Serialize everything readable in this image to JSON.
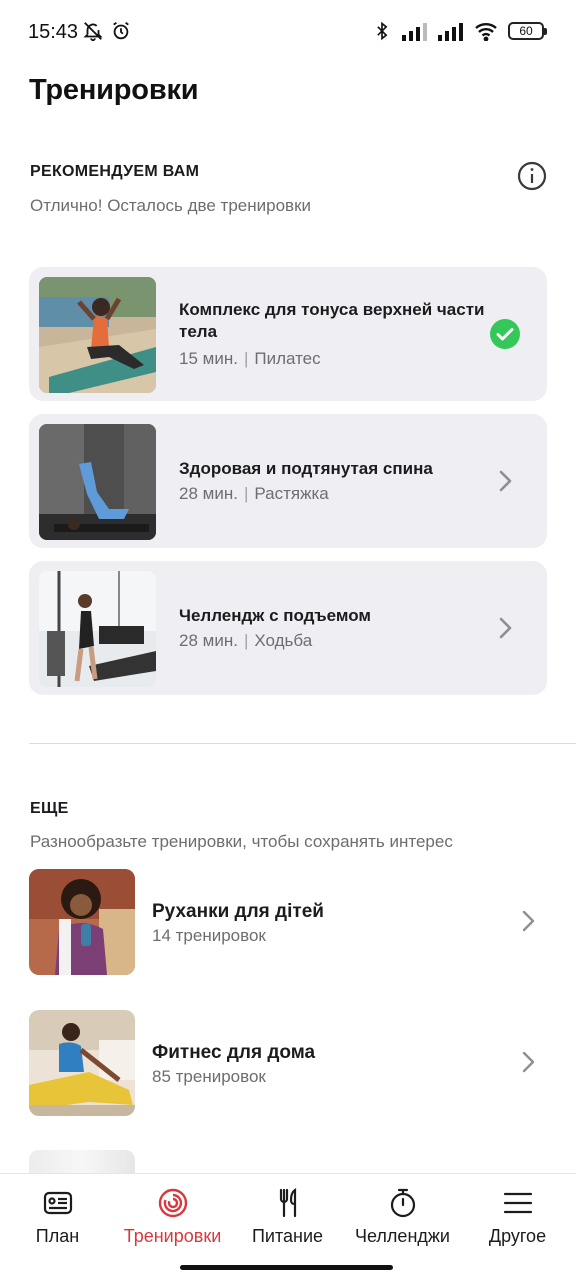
{
  "status": {
    "time": "15:43",
    "battery": "60",
    "icons": [
      "bell-off-icon",
      "alarm-icon",
      "bluetooth-icon",
      "signal-icon",
      "signal-icon",
      "wifi-icon",
      "battery-icon"
    ]
  },
  "page": {
    "title": "Тренировки"
  },
  "recommended": {
    "title": "РЕКОМЕНДУЕМ ВАМ",
    "subtitle": "Отлично! Осталось две тренировки",
    "info_icon": "info-icon",
    "items": [
      {
        "title": "Комплекс для тонуса верхней части тела",
        "duration": "15 мин.",
        "category": "Пилатес",
        "status": "completed",
        "icon": "check-circle-icon"
      },
      {
        "title": "Здоровая и подтянутая спина",
        "duration": "28 мин.",
        "category": "Растяжка",
        "status": "open",
        "icon": "chevron-right-icon"
      },
      {
        "title": "Челлендж с подъемом",
        "duration": "28 мин.",
        "category": "Ходьба",
        "status": "open",
        "icon": "chevron-right-icon"
      }
    ]
  },
  "more": {
    "title": "ЕЩЕ",
    "subtitle": "Разнообразьте тренировки, чтобы сохранять интерес",
    "items": [
      {
        "title": "Руханки для дітей",
        "count": "14 тренировок"
      },
      {
        "title": "Фитнес для дома",
        "count": "85 тренировок"
      }
    ]
  },
  "nav": {
    "items": [
      {
        "label": "План",
        "icon": "plan-card-icon",
        "active": false
      },
      {
        "label": "Тренировки",
        "icon": "workouts-rings-icon",
        "active": true
      },
      {
        "label": "Питание",
        "icon": "fork-knife-icon",
        "active": false
      },
      {
        "label": "Челленджи",
        "icon": "stopwatch-icon",
        "active": false
      },
      {
        "label": "Другое",
        "icon": "menu-icon",
        "active": false
      }
    ]
  },
  "colors": {
    "accent": "#d9373d",
    "check": "#34c759",
    "card_bg": "#efeff3",
    "muted_text": "#6d6d72"
  }
}
